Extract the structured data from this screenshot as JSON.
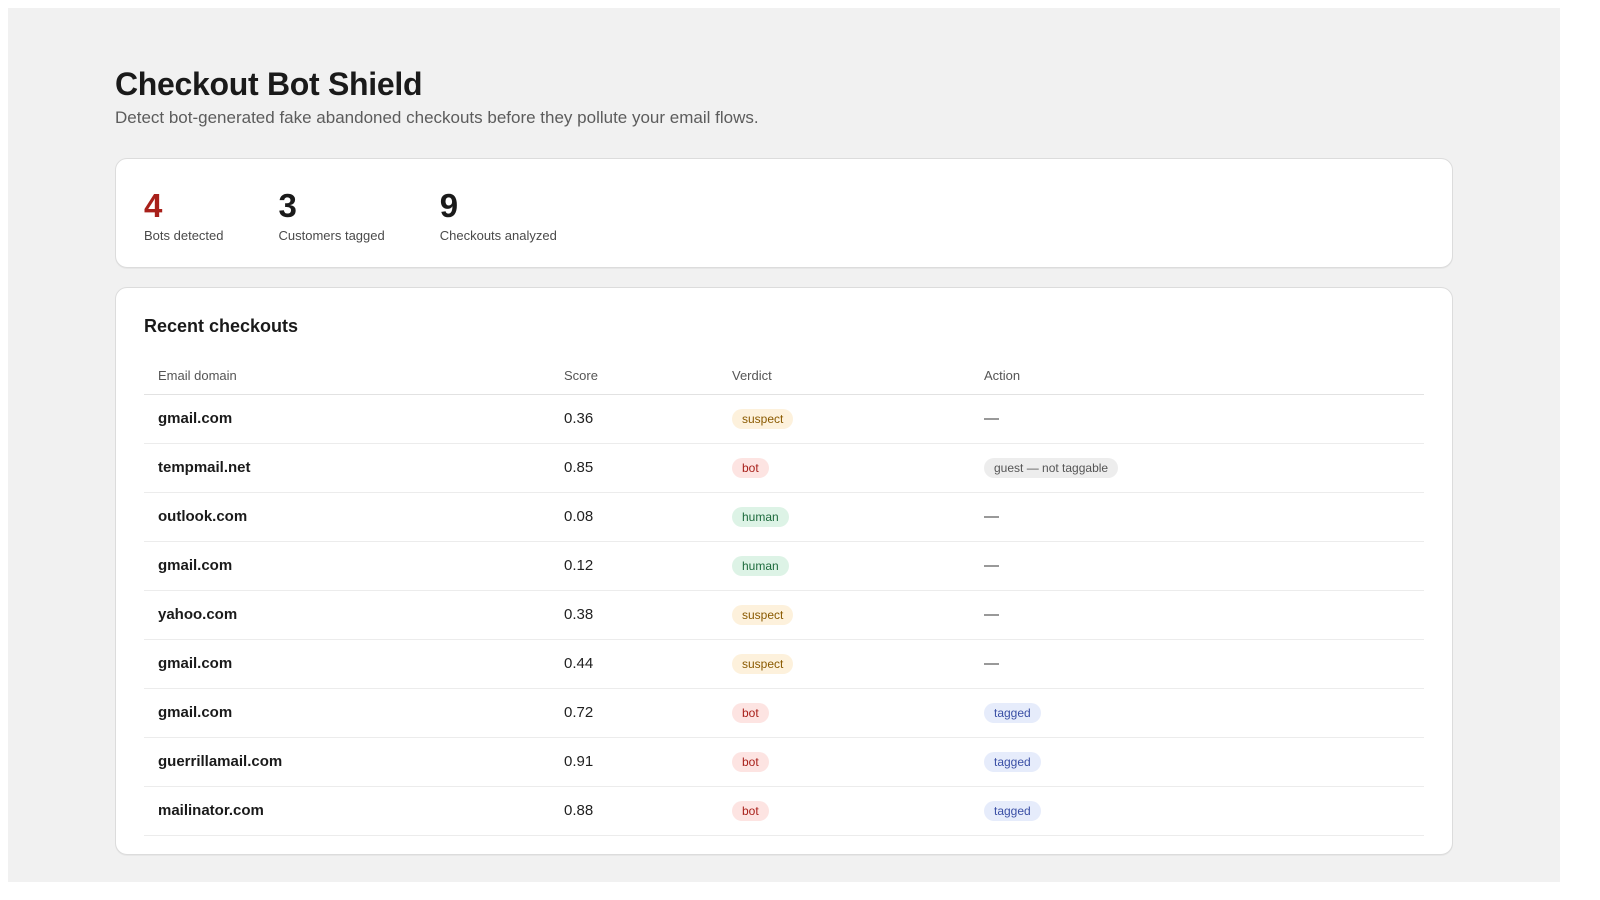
{
  "header": {
    "title": "Checkout Bot Shield",
    "subtitle": "Detect bot-generated fake abandoned checkouts before they pollute your email flows."
  },
  "stats": [
    {
      "value": "4",
      "label": "Bots detected",
      "color": "#a8201a"
    },
    {
      "value": "3",
      "label": "Customers tagged"
    },
    {
      "value": "9",
      "label": "Checkouts analyzed"
    }
  ],
  "table": {
    "title": "Recent checkouts",
    "columns": [
      "Email domain",
      "Score",
      "Verdict",
      "Action"
    ],
    "rows": [
      {
        "domain": "gmail.com",
        "score": "0.36",
        "verdict": "suspect",
        "action": "—"
      },
      {
        "domain": "tempmail.net",
        "score": "0.85",
        "verdict": "bot",
        "action": "guest — not taggable"
      },
      {
        "domain": "outlook.com",
        "score": "0.08",
        "verdict": "human",
        "action": "—"
      },
      {
        "domain": "gmail.com",
        "score": "0.12",
        "verdict": "human",
        "action": "—"
      },
      {
        "domain": "yahoo.com",
        "score": "0.38",
        "verdict": "suspect",
        "action": "—"
      },
      {
        "domain": "gmail.com",
        "score": "0.44",
        "verdict": "suspect",
        "action": "—"
      },
      {
        "domain": "gmail.com",
        "score": "0.72",
        "verdict": "bot",
        "action": "tagged"
      },
      {
        "domain": "guerrillamail.com",
        "score": "0.91",
        "verdict": "bot",
        "action": "tagged"
      },
      {
        "domain": "mailinator.com",
        "score": "0.88",
        "verdict": "bot",
        "action": "tagged"
      }
    ]
  },
  "colors": {
    "suspect_bg": "#fdf1dc",
    "suspect_fg": "#8a5a00",
    "bot_bg": "#fde4e2",
    "bot_fg": "#a8201a",
    "human_bg": "#ddf3e6",
    "human_fg": "#1d6b3d",
    "tagged_bg": "#e6ecfb",
    "tagged_fg": "#3a4fa5"
  }
}
